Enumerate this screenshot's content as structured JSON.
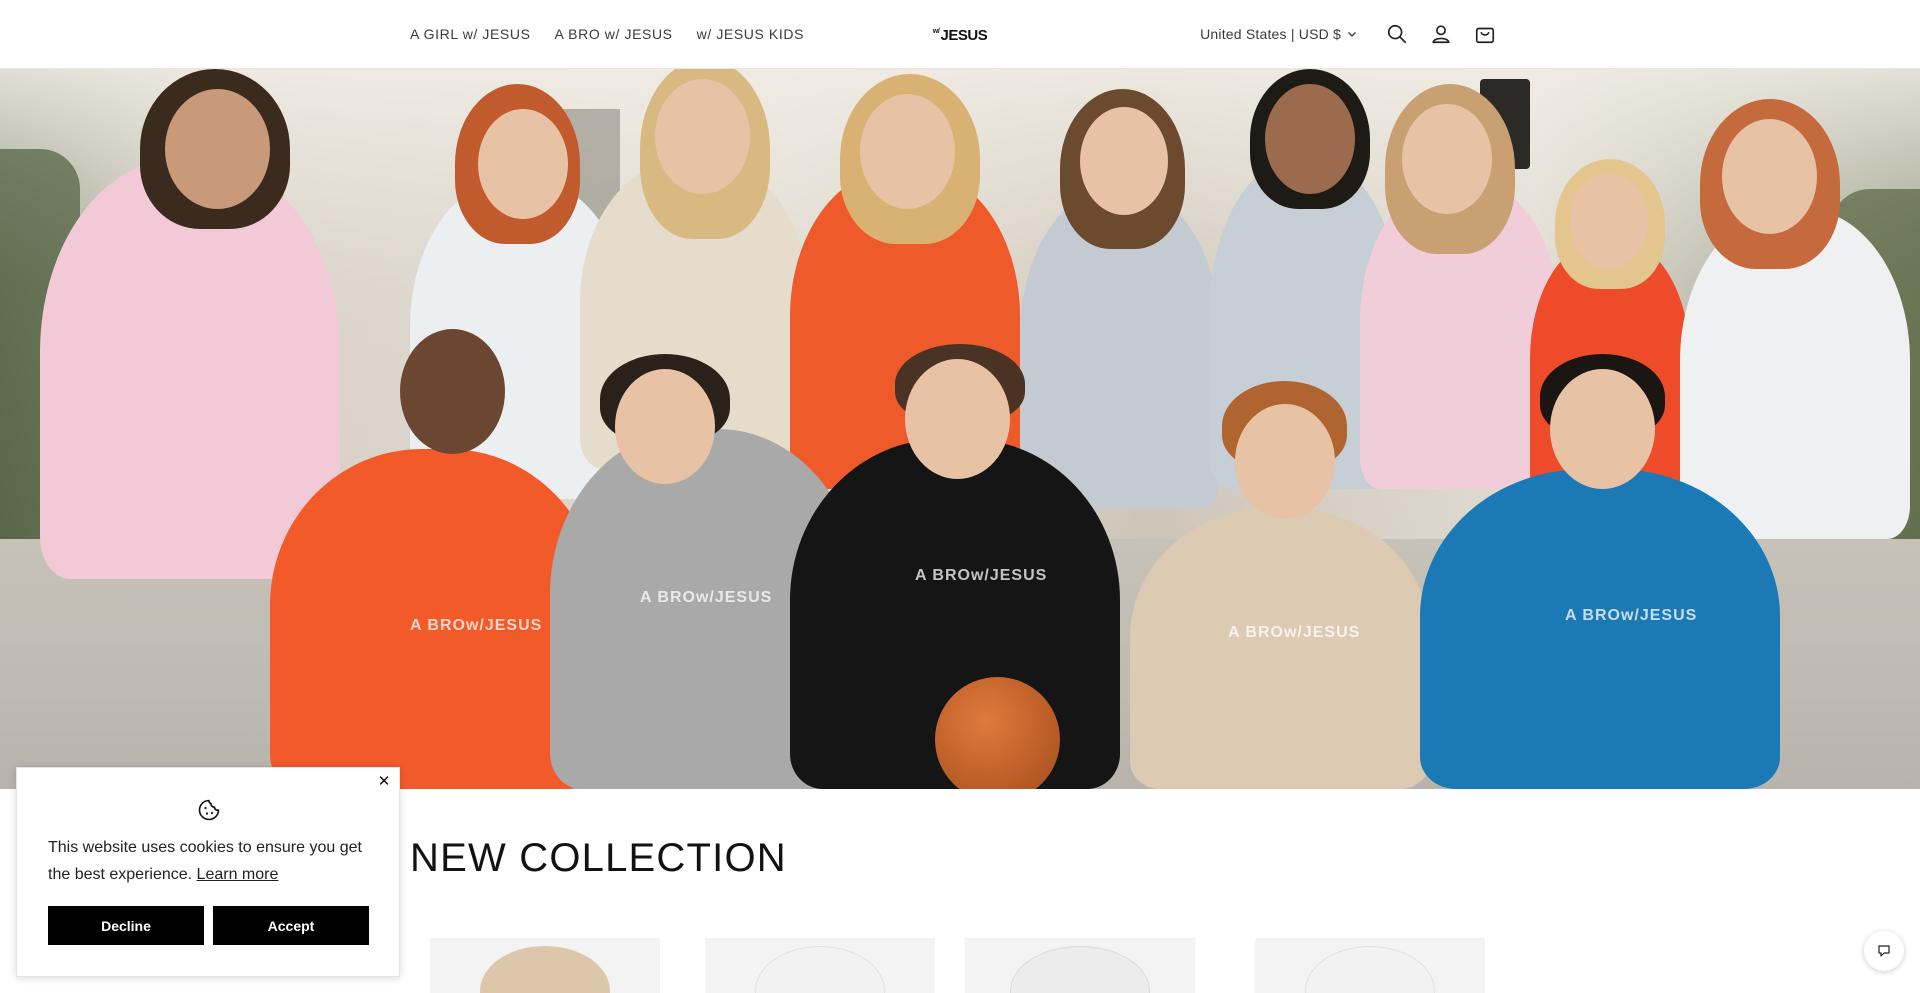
{
  "header": {
    "nav": [
      {
        "label": "A GIRL w/ JESUS"
      },
      {
        "label": "A BRO w/ JESUS"
      },
      {
        "label": "w/ JESUS KIDS"
      }
    ],
    "logo": {
      "sup": "w/",
      "main": "JESUS"
    },
    "locale": "United States | USD $"
  },
  "hero": {
    "hoodie_prints": [
      "A BROw/JESUS",
      "A BROw/JESUS",
      "A BROw/JESUS",
      "A BROw/JESUS",
      "A BROw/JESUS"
    ]
  },
  "collection": {
    "title": "NEW COLLECTION"
  },
  "cookie": {
    "text": "This website uses cookies to ensure you get the best experience.",
    "learn_more": "Learn more",
    "decline": "Decline",
    "accept": "Accept",
    "close": "✕"
  },
  "colors": {
    "button": "#000000",
    "text": "#121212"
  },
  "icons": [
    "chevron-down-icon",
    "search-icon",
    "account-icon",
    "cart-icon",
    "close-icon",
    "cookie-icon",
    "chat-icon"
  ]
}
